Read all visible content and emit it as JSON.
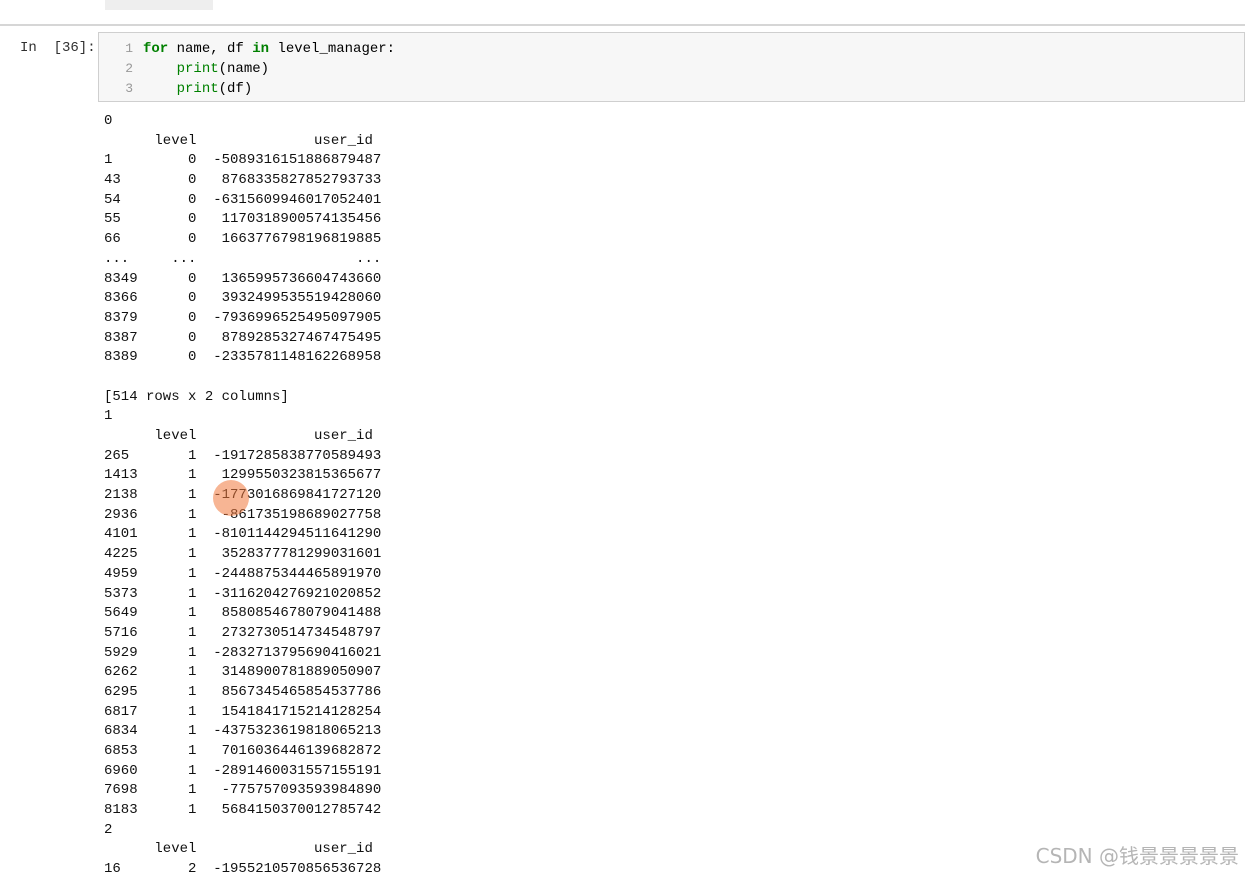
{
  "cell": {
    "prompt": "In  [36]:",
    "line_numbers": [
      "1",
      "2",
      "3"
    ],
    "code": [
      {
        "parts": [
          [
            "kw",
            "for"
          ],
          [
            "t",
            " name, df "
          ],
          [
            "kw",
            "in"
          ],
          [
            "t",
            " level_manager:"
          ]
        ]
      },
      {
        "parts": [
          [
            "t",
            "    "
          ],
          [
            "bi",
            "print"
          ],
          [
            "t",
            "(name)"
          ]
        ]
      },
      {
        "parts": [
          [
            "t",
            "    "
          ],
          [
            "bi",
            "print"
          ],
          [
            "t",
            "(df)"
          ]
        ]
      }
    ]
  },
  "output": [
    "0",
    "      level              user_id",
    "1         0  -5089316151886879487",
    "43        0   8768335827852793733",
    "54        0  -6315609946017052401",
    "55        0   1170318900574135456",
    "66        0   1663776798196819885",
    "...     ...                   ...",
    "8349      0   1365995736604743660",
    "8366      0   3932499535519428060",
    "8379      0  -7936996525495097905",
    "8387      0   8789285327467475495",
    "8389      0  -2335781148162268958",
    "",
    "[514 rows x 2 columns]",
    "1",
    "      level              user_id",
    "265       1  -1917285838770589493",
    "1413      1   1299550323815365677",
    "2138      1  -1773016869841727120",
    "2936      1   -861735198689027758",
    "4101      1  -8101144294511641290",
    "4225      1   3528377781299031601",
    "4959      1  -2448875344465891970",
    "5373      1  -3116204276921020852",
    "5649      1   8580854678079041488",
    "5716      1   2732730514734548797",
    "5929      1  -2832713795690416021",
    "6262      1   3148900781889050907",
    "6295      1   8567345465854537786",
    "6817      1   1541841715214128254",
    "6834      1  -4375323619818065213",
    "6853      1   7016036446139682872",
    "6960      1  -2891460031557155191",
    "7698      1   -775757093593984890",
    "8183      1   5684150370012785742",
    "2",
    "      level              user_id",
    "16        2  -1955210570856536728"
  ],
  "watermark": "CSDN @钱景景景景景",
  "colors": {
    "keyword": "#008000",
    "input_bg": "#f7f7f7",
    "cursor": "#f0783c"
  }
}
